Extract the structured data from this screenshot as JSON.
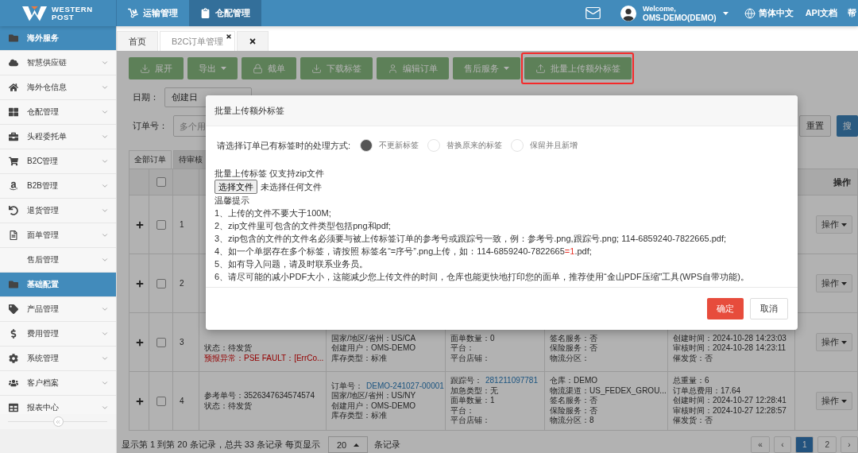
{
  "top_bar": {
    "logo": {
      "line_1": "WESTERN",
      "line_2": "POST"
    },
    "nav": [
      {
        "label": "运输管理",
        "selected": false
      },
      {
        "label": "仓配管理",
        "selected": true
      }
    ],
    "user": {
      "greeting": "Welcome,",
      "name": "OMS-DEMO(DEMO)"
    },
    "language": "简体中文",
    "links": [
      "API文档",
      "帮"
    ]
  },
  "sidebar": {
    "items": [
      {
        "kind": "group",
        "label": "海外服务"
      },
      {
        "kind": "item",
        "label": "智慧供应链"
      },
      {
        "kind": "item",
        "label": "海外仓信息"
      },
      {
        "kind": "item",
        "label": "仓配管理"
      },
      {
        "kind": "item",
        "label": "头程委托单"
      },
      {
        "kind": "item",
        "label": "B2C管理"
      },
      {
        "kind": "item",
        "label": "B2B管理"
      },
      {
        "kind": "item",
        "label": "退货管理"
      },
      {
        "kind": "item",
        "label": "面单管理"
      },
      {
        "kind": "item",
        "label": "售后管理"
      },
      {
        "kind": "group",
        "label": "基础配置"
      },
      {
        "kind": "item",
        "label": "产品管理"
      },
      {
        "kind": "item",
        "label": "费用管理"
      },
      {
        "kind": "item",
        "label": "系统管理"
      },
      {
        "kind": "item",
        "label": "客户档案"
      },
      {
        "kind": "item",
        "label": "报表中心"
      }
    ]
  },
  "page_tabs": [
    {
      "kind": "page",
      "label": "首页",
      "selected": false,
      "closable": false
    },
    {
      "kind": "page",
      "label": "B2C订单管理",
      "selected": true,
      "closable": true
    },
    {
      "kind": "close"
    }
  ],
  "toolbar": {
    "buttons": [
      {
        "label": "展开",
        "dropdown": false,
        "highlighted": false
      },
      {
        "label": "导出",
        "dropdown": true,
        "highlighted": false
      },
      {
        "label": "截单",
        "dropdown": false,
        "highlighted": false
      },
      {
        "label": "下载标签",
        "dropdown": false,
        "highlighted": false
      },
      {
        "label": "编辑订单",
        "dropdown": false,
        "highlighted": false
      },
      {
        "label": "售后服务",
        "dropdown": true,
        "highlighted": false
      },
      {
        "label": "批量上传额外标签",
        "dropdown": false,
        "highlighted": true
      }
    ]
  },
  "filters": {
    "date_label": "日期：",
    "date_type": "创建日",
    "order_label": "订单号：",
    "order_placeholder": "多个用",
    "buttons": [
      {
        "kind": "default",
        "label": "重置"
      },
      {
        "kind": "primary",
        "label": "搜"
      }
    ]
  },
  "table": {
    "tabs": [
      {
        "label": "全部订单",
        "selected": true
      },
      {
        "label": "待审核",
        "selected": false
      }
    ],
    "select_all_checked": false,
    "action_heading": "操作",
    "rows": [
      {
        "kind": "covered",
        "number": "1",
        "checked": false,
        "action": "操作"
      },
      {
        "kind": "covered",
        "number": "2",
        "checked": false,
        "action": "操作"
      },
      {
        "kind": "cut",
        "number": "3",
        "checked": false,
        "action": "操作",
        "columns": [
          [
            {
              "kind": "plain",
              "text": "状态：待发货"
            },
            {
              "kind": "error",
              "text": "预报异常：PSE FAULT：[ErrCo..."
            }
          ],
          [
            {
              "kind": "plain",
              "text": "国家/地区/省州：US/CA"
            },
            {
              "kind": "plain",
              "text": "创建用户：OMS-DEMO"
            },
            {
              "kind": "plain",
              "text": "库存类型：标准"
            }
          ],
          [
            {
              "kind": "plain",
              "text": "面单数量：0"
            },
            {
              "kind": "plain",
              "text": "平台："
            },
            {
              "kind": "plain",
              "text": "平台店铺："
            }
          ],
          [
            {
              "kind": "plain",
              "text": "签名服务：否"
            },
            {
              "kind": "plain",
              "text": "保险服务：否"
            },
            {
              "kind": "plain",
              "text": "物流分区："
            }
          ],
          [
            {
              "kind": "plain",
              "text": "创建时间：2024-10-28 14:23:03"
            },
            {
              "kind": "plain",
              "text": "审核时间：2024-10-28 14:23:11"
            },
            {
              "kind": "plain",
              "text": "催发货：否"
            }
          ]
        ]
      },
      {
        "kind": "full",
        "number": "4",
        "checked": false,
        "action": "操作",
        "columns": [
          [
            {
              "kind": "plain",
              "text": "参考单号：3526347634574574"
            },
            {
              "kind": "plain",
              "text": "状态：待发货"
            }
          ],
          [
            {
              "kind": "plain",
              "text": "订单号：",
              "link": "DEMO-241027-00001"
            },
            {
              "kind": "plain",
              "text": "国家/地区/省州：US/NY"
            },
            {
              "kind": "plain",
              "text": "创建用户：OMS-DEMO"
            },
            {
              "kind": "plain",
              "text": "库存类型：标准"
            }
          ],
          [
            {
              "kind": "plain",
              "text": "跟踪号：",
              "link": "281211097781"
            },
            {
              "kind": "plain",
              "text": "加急类型：无"
            },
            {
              "kind": "plain",
              "text": "面单数量：1"
            },
            {
              "kind": "plain",
              "text": "平台："
            },
            {
              "kind": "plain",
              "text": "平台店铺："
            }
          ],
          [
            {
              "kind": "plain",
              "text": "仓库：DEMO"
            },
            {
              "kind": "plain",
              "text": "物流渠道：US_FEDEX_GROU..."
            },
            {
              "kind": "plain",
              "text": "签名服务：否"
            },
            {
              "kind": "plain",
              "text": "保险服务：否"
            },
            {
              "kind": "plain",
              "text": "物流分区：8"
            }
          ],
          [
            {
              "kind": "plain",
              "text": "总重量：6"
            },
            {
              "kind": "plain",
              "text": "订单总费用：17.64"
            },
            {
              "kind": "plain",
              "text": "创建时间：2024-10-27 12:28:41"
            },
            {
              "kind": "plain",
              "text": "审核时间：2024-10-27 12:28:57"
            },
            {
              "kind": "plain",
              "text": "催发货：否"
            }
          ]
        ]
      }
    ]
  },
  "footer": {
    "summary": "显示第 1 到第 20 条记录，总共 33 条记录 每页显示",
    "page_size": "20",
    "unit": "条记录",
    "pages": [
      {
        "label": "«",
        "selected": false
      },
      {
        "label": "‹",
        "selected": false
      },
      {
        "label": "1",
        "selected": true
      },
      {
        "label": "2",
        "selected": false
      },
      {
        "label": "›",
        "selected": false
      }
    ]
  },
  "modal": {
    "title": "批量上传额外标签",
    "mode_label": "请选择订单已有标签时的处理方式:",
    "modes": [
      {
        "label": "不更新标签",
        "selected": true
      },
      {
        "label": "替换原来的标签",
        "selected": false
      },
      {
        "label": "保留并且新增",
        "selected": false
      }
    ],
    "upload_label": "批量上传标签 仅支持zip文件",
    "file_button": "选择文件",
    "file_status": "未选择任何文件",
    "tips_title": "温馨提示",
    "tips": [
      {
        "text": "1、上传的文件不要大于100M;"
      },
      {
        "text": "2、zip文件里可包含的文件类型包括png和pdf;"
      },
      {
        "text": "3、zip包含的文件的文件名必须要与被上传标签订单的参考号或跟踪号一致，例：参考号.png,跟踪号.png; 114-6859240-7822665.pdf;"
      },
      {
        "text": "4、如一个单据存在多个标签，请按照 标签名“=序号”.png上传，如：114-6859240-7822665",
        "highlight": "=1",
        "after": ".pdf;"
      },
      {
        "text": "5、如有导入问题，请及时联系业务员。"
      },
      {
        "text": "6、请尽可能的减小PDF大小，这能减少您上传文件的时间，仓库也能更快地打印您的面单，推荐使用“金山PDF压缩”工具(WPS自带功能)。"
      }
    ],
    "buttons": [
      {
        "kind": "primary",
        "label": "确定"
      },
      {
        "kind": "default",
        "label": "取消"
      }
    ]
  }
}
